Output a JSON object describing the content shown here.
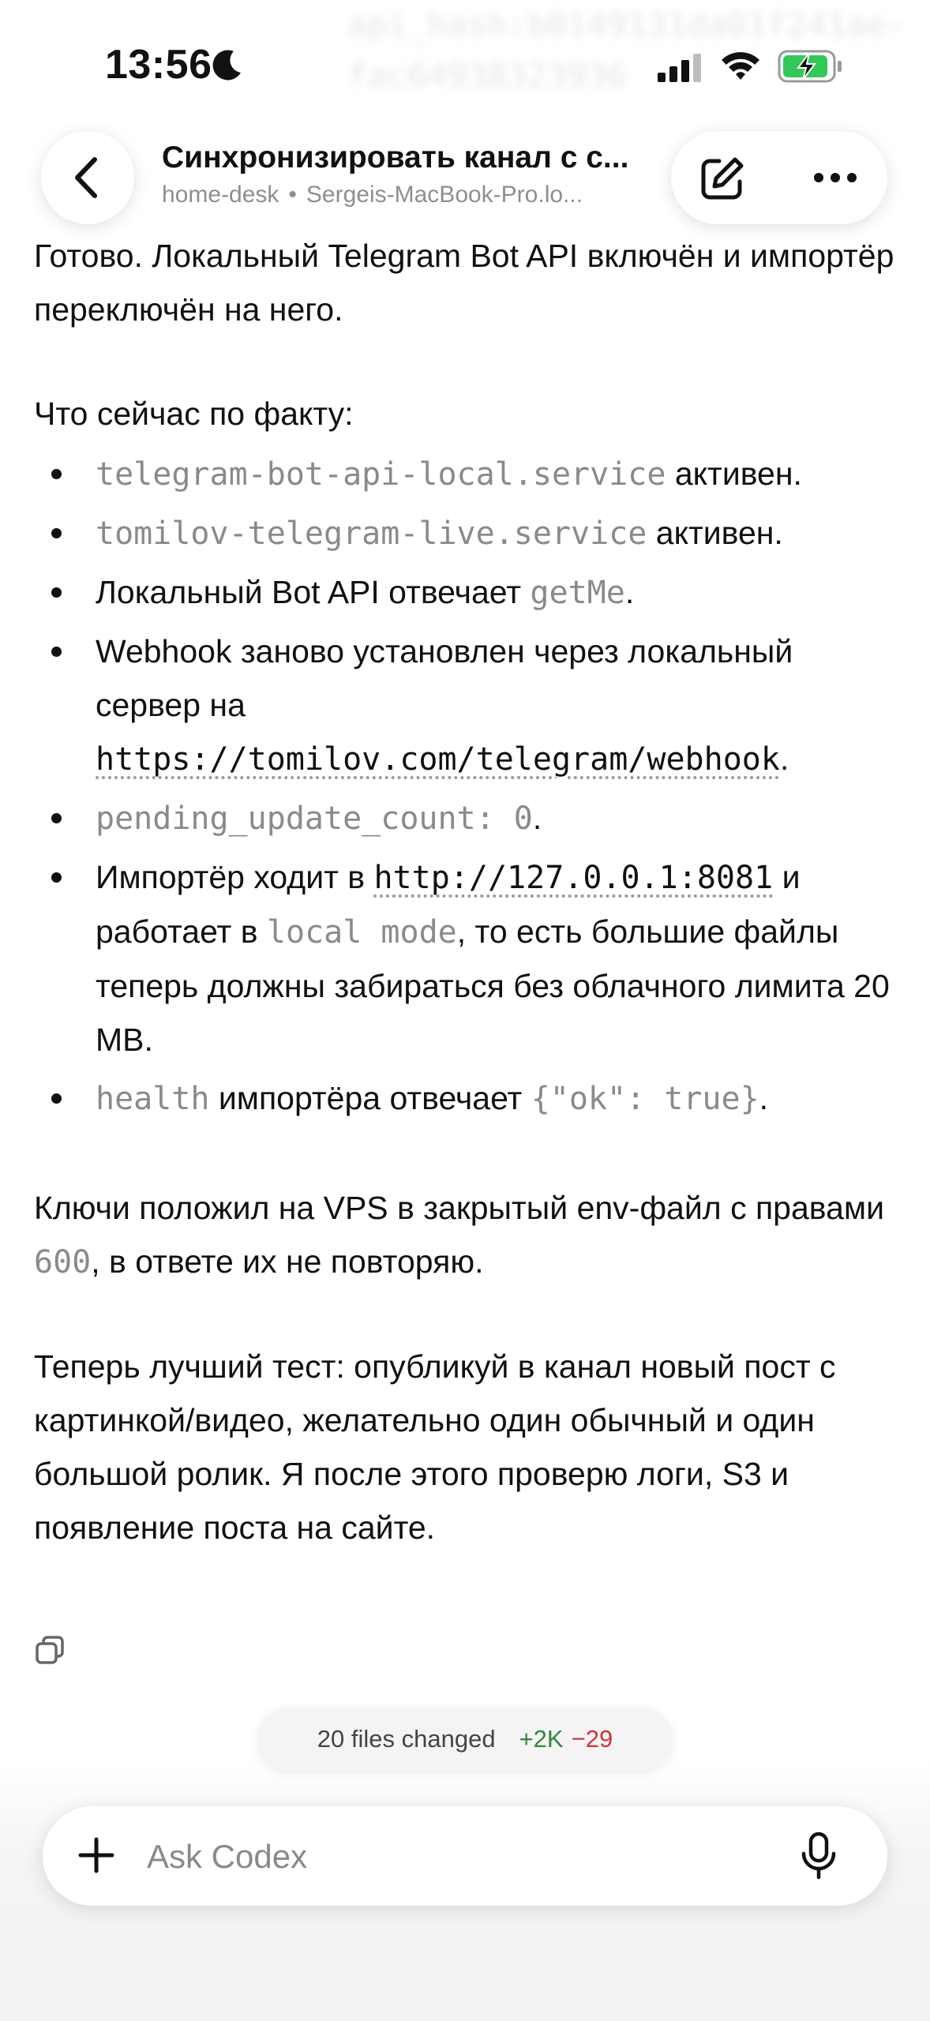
{
  "status_bar": {
    "time": "13:56",
    "background_text_line1": "api_hash:b8149131da01f241ae-",
    "background_text_line2": "fac64938323936",
    "icons": [
      "moon-icon",
      "signal-icon",
      "wifi-icon",
      "battery-charging-icon"
    ]
  },
  "header": {
    "title": "Синхронизировать канал с с...",
    "subtitle_project": "home-desk",
    "subtitle_host": "Sergeis-MacBook-Pro.lo...",
    "icons": [
      "chevron-left-icon",
      "edit-icon",
      "more-icon"
    ]
  },
  "message": {
    "intro": "Готово. Локальный Telegram Bot API включён и импортёр переключён на него.",
    "facts_heading": "Что сейчас по факту:",
    "bullets": {
      "b1_code": "telegram-bot-api-local.service",
      "b1_text": " активен.",
      "b2_code": "tomilov-telegram-live.service",
      "b2_text": " активен.",
      "b3_text": "Локальный Bot API отвечает ",
      "b3_code": "getMe",
      "b3_end": ".",
      "b4_text": "Webhook заново установлен через локальный сервер на ",
      "b4_link": "https://tomilov.com/telegram/webhook",
      "b4_end": ".",
      "b5_code": "pending_update_count: 0",
      "b5_end": ".",
      "b6_text": "Импортёр ходит в ",
      "b6_link": "http://127.0.0.1:8081",
      "b6_mid": " и работает в ",
      "b6_code": "local mode",
      "b6_end": ", то есть большие файлы теперь должны забираться без облачного лимита 20 MB.",
      "b7_code": "health",
      "b7_text": " импортёра отвечает ",
      "b7_code2": "{\"ok\": true}",
      "b7_end": "."
    },
    "keys_text": "Ключи положил на VPS в закрытый env-файл с правами ",
    "keys_code": "600",
    "keys_end": ", в ответе их не повторяю.",
    "final": "Теперь лучший тест: опубликуй в канал новый пост с картинкой/видео, желательно один обычный и один большой ролик. Я после этого проверю логи, S3 и появление поста на сайте."
  },
  "files_changed": {
    "label": "20 files changed",
    "added": "+2K",
    "removed": "−29",
    "colors": {
      "added": "#2e8b3a",
      "removed": "#d0343a"
    }
  },
  "composer": {
    "placeholder": "Ask Codex",
    "icons": [
      "plus-icon",
      "mic-icon"
    ]
  }
}
